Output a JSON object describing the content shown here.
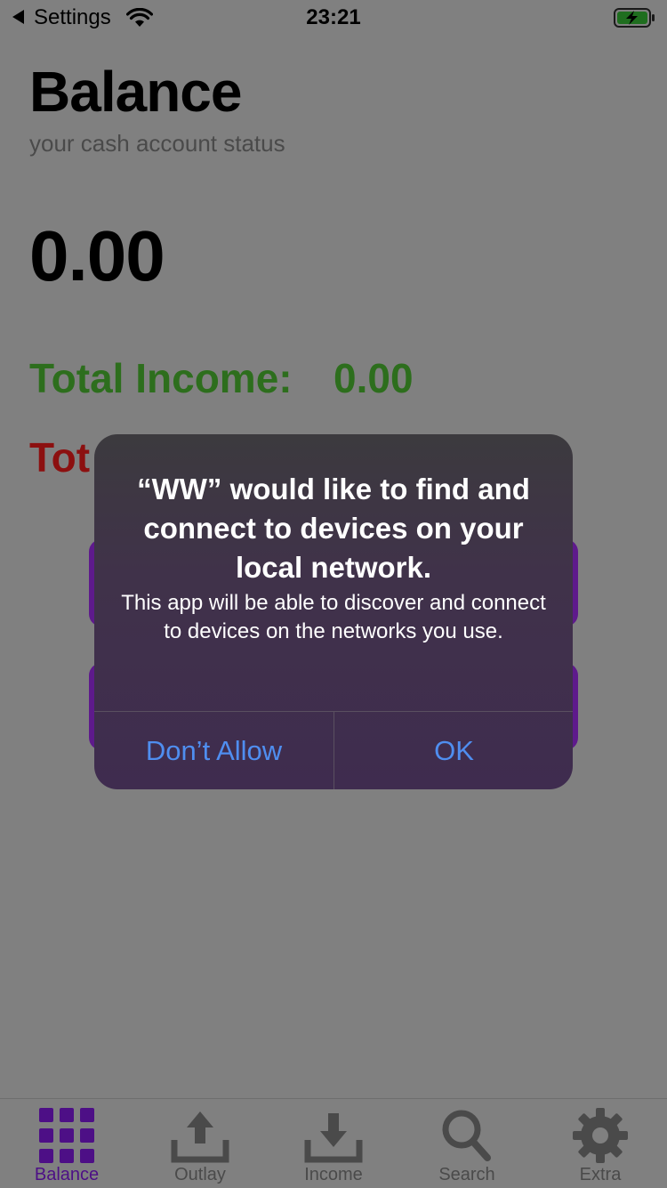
{
  "status_bar": {
    "back_label": "Settings",
    "time": "23:21"
  },
  "header": {
    "title": "Balance",
    "subtitle": "your cash account status"
  },
  "balance": {
    "amount": "0.00"
  },
  "totals": {
    "income_label": "Total Income:",
    "income_value": "0.00",
    "outlay_label_visible": "Tot"
  },
  "alert": {
    "title": "“WW” would like to find and connect to devices on your local network.",
    "message": "This app will be able to discover and connect to devices on the networks you use.",
    "deny_label": "Don’t Allow",
    "ok_label": "OK"
  },
  "tab_bar": {
    "tabs": [
      {
        "label": "Balance",
        "icon": "grid-icon",
        "active": true
      },
      {
        "label": "Outlay",
        "icon": "upload-icon"
      },
      {
        "label": "Income",
        "icon": "download-icon"
      },
      {
        "label": "Search",
        "icon": "search-icon"
      },
      {
        "label": "Extra",
        "icon": "gear-icon"
      }
    ]
  },
  "colors": {
    "accent": "#4d0f86",
    "income": "#2d6e1d",
    "outlay": "#8c1010",
    "alert_button": "#4f8ef0"
  }
}
